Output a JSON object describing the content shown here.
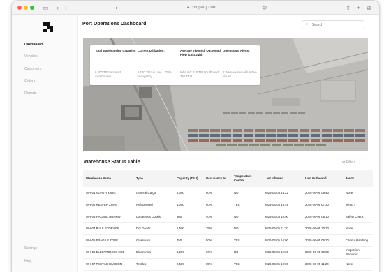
{
  "browser": {
    "url": "company.com"
  },
  "sidebar": {
    "items": [
      {
        "label": "Dashboard",
        "active": true
      },
      {
        "label": "Vehicles",
        "active": false
      },
      {
        "label": "Customers",
        "active": false
      },
      {
        "label": "Orders",
        "active": false
      },
      {
        "label": "Reports",
        "active": false
      }
    ],
    "bottom": [
      {
        "label": "Settings"
      },
      {
        "label": "Help"
      }
    ]
  },
  "header": {
    "title": "Port Operations Dashboard",
    "search_placeholder": "Search"
  },
  "stats": [
    {
      "label": "Total Warehousing Capacity:",
      "value": "8,200 TEU across 5 warehouses"
    },
    {
      "label": "Current Utilization:",
      "value": "6,140 TEU in use → 75% occupancy"
    },
    {
      "label": "Average Inbound/ Outbound Flow (Last 24h):",
      "value": "Inbound: 410 TEU Outbound: 390 TEU"
    },
    {
      "label": "Operational Alerts:",
      "value": "2 Warehouses with active issues"
    }
  ],
  "table": {
    "title": "Warehouse Status Table",
    "filters_label": "Filters",
    "columns": [
      "Warehouse Name",
      "Type",
      "Capacity (TEU)",
      "Occupancy %",
      "Temperature Control",
      "Last Inbound",
      "Last Outbound",
      "Alerts"
    ],
    "rows": [
      [
        "WH-01 NORTH YARD",
        "General Cargo",
        "2,000",
        "80%",
        "NO",
        "2025-06-05 14:22",
        "2025-06-05 09:43",
        "None"
      ],
      [
        "WH-02 REEFER ZONE",
        "Refrigerated",
        "1,000",
        "60%",
        "YES",
        "2025-06-05 15:48",
        "2025-06-05 07:30",
        "Temp ↑"
      ],
      [
        "WH-03 HAZARD BUNKER",
        "Dangerous Goods",
        "500",
        "40%",
        "NO",
        "2025-06-04 16:00",
        "2025-06-05 08:10",
        "Safety Check"
      ],
      [
        "WH-04 BULK STORAGE",
        "Dry Goods",
        "1,500",
        "75%",
        "NO",
        "2025-06-05 11:30",
        "2025-06-05 10:10",
        "None"
      ],
      [
        "WH-05 FRAGILE ZONE",
        "Glassware",
        "750",
        "50%",
        "YES",
        "2025-06-05 16:00",
        "2025-06-05 06:30",
        "Careful Handling"
      ],
      [
        "WH-06 ELECTRONICS HUB",
        "Electronics",
        "1,200",
        "90%",
        "NO",
        "2025-06-05 12:30",
        "2025-06-05 09:00",
        "Inspection Required"
      ],
      [
        "WH-07 TEXTILE DIVISION",
        "Textiles",
        "2,500",
        "85%",
        "YES",
        "2025-06-05 10:00",
        "2025-06-05 11:20",
        "None"
      ]
    ]
  }
}
